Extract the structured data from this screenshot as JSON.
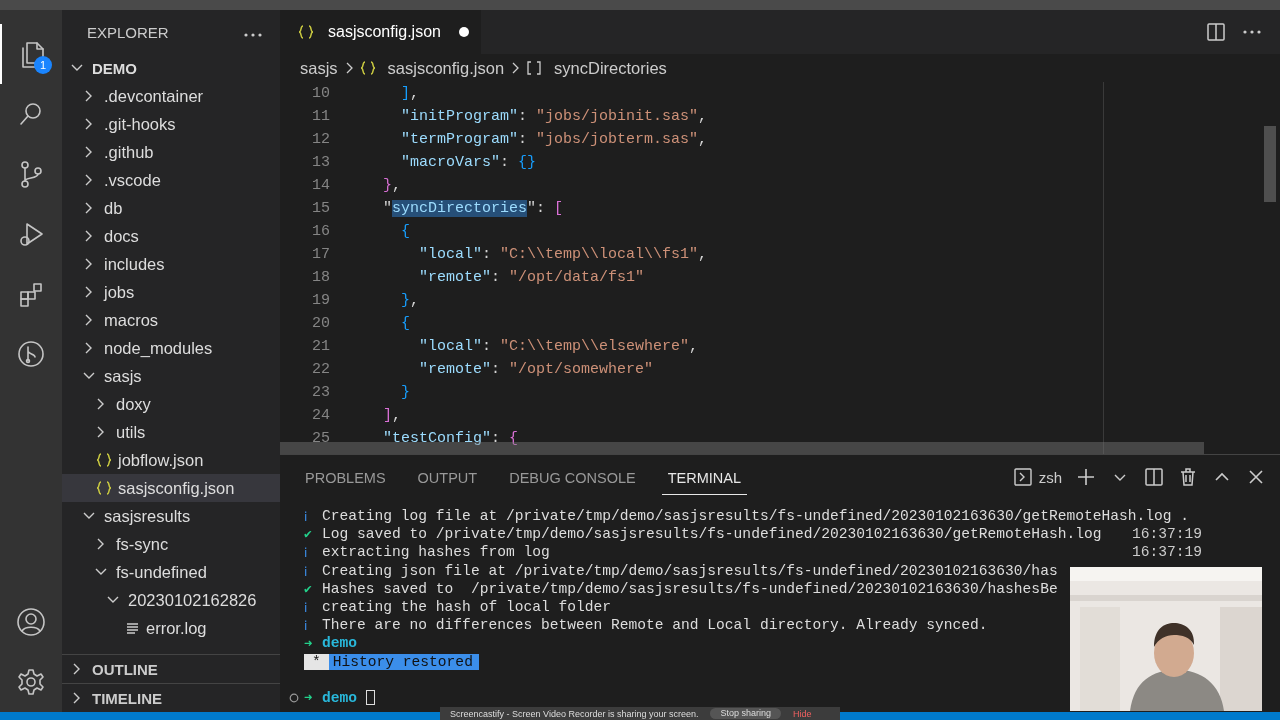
{
  "activity_bar": {
    "items": [
      {
        "selected": true,
        "badge": "1"
      },
      {
        "selected": false
      },
      {
        "selected": false
      },
      {
        "selected": false
      },
      {
        "selected": false
      },
      {
        "selected": false
      }
    ]
  },
  "sidebar": {
    "title": "EXPLORER",
    "root": {
      "label": "DEMO",
      "expanded": true
    },
    "items": [
      {
        "label": ".devcontainer",
        "kind": "folder",
        "expanded": false,
        "selected": false
      },
      {
        "label": ".git-hooks",
        "kind": "folder",
        "expanded": false,
        "selected": false
      },
      {
        "label": ".github",
        "kind": "folder",
        "expanded": false,
        "selected": false
      },
      {
        "label": ".vscode",
        "kind": "folder",
        "expanded": false,
        "selected": false
      },
      {
        "label": "db",
        "kind": "folder",
        "expanded": false,
        "selected": false
      },
      {
        "label": "docs",
        "kind": "folder",
        "expanded": false,
        "selected": false
      },
      {
        "label": "includes",
        "kind": "folder",
        "expanded": false,
        "selected": false
      },
      {
        "label": "jobs",
        "kind": "folder",
        "expanded": false,
        "selected": false
      },
      {
        "label": "macros",
        "kind": "folder",
        "expanded": false,
        "selected": false
      },
      {
        "label": "node_modules",
        "kind": "folder",
        "expanded": false,
        "selected": false
      },
      {
        "label": "sasjs",
        "kind": "folder",
        "expanded": true,
        "selected": false,
        "children": [
          {
            "label": "doxy",
            "kind": "folder",
            "expanded": false,
            "selected": false
          },
          {
            "label": "utils",
            "kind": "folder",
            "expanded": false,
            "selected": false
          },
          {
            "label": "jobflow.json",
            "kind": "json",
            "selected": false
          },
          {
            "label": "sasjsconfig.json",
            "kind": "json",
            "selected": true
          }
        ]
      },
      {
        "label": "sasjsresults",
        "kind": "folder",
        "expanded": true,
        "selected": false,
        "children": [
          {
            "label": "fs-sync",
            "kind": "folder",
            "expanded": false,
            "selected": false
          },
          {
            "label": "fs-undefined",
            "kind": "folder",
            "expanded": true,
            "selected": false,
            "children": [
              {
                "label": "20230102162826",
                "kind": "folder",
                "expanded": true,
                "selected": false,
                "children": [
                  {
                    "label": "error.log",
                    "kind": "log",
                    "selected": false
                  }
                ]
              }
            ]
          }
        ]
      }
    ],
    "sections": [
      {
        "label": "OUTLINE",
        "expanded": false
      },
      {
        "label": "TIMELINE",
        "expanded": false
      }
    ]
  },
  "editor": {
    "tabs": [
      {
        "label": "sasjsconfig.json",
        "selected": true,
        "modified": true
      }
    ],
    "breadcrumbs": [
      {
        "label": "sasjs",
        "kind": "folder"
      },
      {
        "label": "sasjsconfig.json",
        "kind": "json"
      },
      {
        "label": "syncDirectories",
        "kind": "array"
      }
    ],
    "lines": [
      {
        "number": "10",
        "tokens": [
          {
            "kind": "bracket",
            "text": "]"
          },
          {
            "kind": "punct",
            "text": ","
          }
        ]
      },
      {
        "number": "11",
        "tokens": [
          {
            "kind": "key",
            "text": "\"initProgram\""
          },
          {
            "kind": "punct",
            "text": ": "
          },
          {
            "kind": "string",
            "text": "\"jobs/jobinit.sas\""
          },
          {
            "kind": "punct",
            "text": ","
          }
        ]
      },
      {
        "number": "12",
        "tokens": [
          {
            "kind": "key",
            "text": "\"termProgram\""
          },
          {
            "kind": "punct",
            "text": ": "
          },
          {
            "kind": "string",
            "text": "\"jobs/jobterm.sas\""
          },
          {
            "kind": "punct",
            "text": ","
          }
        ]
      },
      {
        "number": "13",
        "tokens": [
          {
            "kind": "key",
            "text": "\"macroVars\""
          },
          {
            "kind": "punct",
            "text": ": "
          },
          {
            "kind": "bracket",
            "text": "{}"
          }
        ]
      },
      {
        "number": "14",
        "tokens": [
          {
            "kind": "bracket",
            "text": "}"
          },
          {
            "kind": "punct",
            "text": ","
          }
        ]
      },
      {
        "number": "15",
        "tokens": [
          {
            "kind": "punct",
            "text": "\""
          },
          {
            "kind": "selection",
            "text": "syncDirectories"
          },
          {
            "kind": "punct",
            "text": "\": "
          },
          {
            "kind": "bracket",
            "text": "["
          }
        ]
      },
      {
        "number": "16",
        "tokens": [
          {
            "kind": "bracket",
            "text": "{"
          }
        ]
      },
      {
        "number": "17",
        "tokens": [
          {
            "kind": "key",
            "text": "\"local\""
          },
          {
            "kind": "punct",
            "text": ": "
          },
          {
            "kind": "string",
            "text": "\"C:\\\\temp\\\\local\\\\fs1\""
          },
          {
            "kind": "punct",
            "text": ","
          }
        ]
      },
      {
        "number": "18",
        "tokens": [
          {
            "kind": "key",
            "text": "\"remote\""
          },
          {
            "kind": "punct",
            "text": ": "
          },
          {
            "kind": "string",
            "text": "\"/opt/data/fs1\""
          }
        ]
      },
      {
        "number": "19",
        "tokens": [
          {
            "kind": "bracket",
            "text": "}"
          },
          {
            "kind": "punct",
            "text": ","
          }
        ]
      },
      {
        "number": "20",
        "tokens": [
          {
            "kind": "bracket",
            "text": "{"
          }
        ]
      },
      {
        "number": "21",
        "tokens": [
          {
            "kind": "key",
            "text": "\"local\""
          },
          {
            "kind": "punct",
            "text": ": "
          },
          {
            "kind": "string",
            "text": "\"C:\\\\temp\\\\elsewhere\""
          },
          {
            "kind": "punct",
            "text": ","
          }
        ]
      },
      {
        "number": "22",
        "tokens": [
          {
            "kind": "key",
            "text": "\"remote\""
          },
          {
            "kind": "punct",
            "text": ": "
          },
          {
            "kind": "string",
            "text": "\"/opt/somewhere\""
          }
        ]
      },
      {
        "number": "23",
        "tokens": [
          {
            "kind": "bracket",
            "text": "}"
          }
        ]
      },
      {
        "number": "24",
        "tokens": [
          {
            "kind": "bracket",
            "text": "]"
          },
          {
            "kind": "punct",
            "text": ","
          }
        ]
      },
      {
        "number": "25",
        "tokens": [
          {
            "kind": "key",
            "text": "\"testConfig\""
          },
          {
            "kind": "punct",
            "text": ": "
          },
          {
            "kind": "bracket",
            "text": "{"
          }
        ]
      }
    ]
  },
  "panel": {
    "tabs": [
      {
        "label": "PROBLEMS",
        "selected": false
      },
      {
        "label": "OUTPUT",
        "selected": false
      },
      {
        "label": "DEBUG CONSOLE",
        "selected": false
      },
      {
        "label": "TERMINAL",
        "selected": true
      }
    ],
    "shell": "zsh",
    "terminal": [
      {
        "kind": "info",
        "mark": "ℹ",
        "text": "Creating log file at /private/tmp/demo/sasjsresults/fs-undefined/20230102163630/getRemoteHash.log ."
      },
      {
        "kind": "success",
        "mark": "✔",
        "text": "Log saved to /private/tmp/demo/sasjsresults/fs-undefined/20230102163630/getRemoteHash.log",
        "time": "16:37:19"
      },
      {
        "kind": "info",
        "mark": "ℹ",
        "text": "extracting hashes from log",
        "time": "16:37:19"
      },
      {
        "kind": "info",
        "mark": "ℹ",
        "text": "Creating json file at /private/tmp/demo/sasjsresults/fs-undefined/20230102163630/has"
      },
      {
        "kind": "success",
        "mark": "✔",
        "text": "Hashes saved to  /private/tmp/demo/sasjsresults/fs-undefined/20230102163630/hashesBe"
      },
      {
        "kind": "info",
        "mark": "ℹ",
        "text": "creating the hash of local folder"
      },
      {
        "kind": "info",
        "mark": "ℹ",
        "text": "There are no differences between Remote and Local directory. Already synced."
      },
      {
        "kind": "prompt",
        "mark": "➜",
        "text": "demo"
      },
      {
        "kind": "history",
        "mark": "*",
        "text": "History restored"
      },
      {
        "kind": "spacer"
      },
      {
        "kind": "input",
        "mark": "➜",
        "text": "demo"
      }
    ]
  },
  "share_bar": {
    "message": "Screencastify - Screen Video Recorder is sharing your screen.",
    "stop": "Stop sharing",
    "hide": "Hide"
  }
}
